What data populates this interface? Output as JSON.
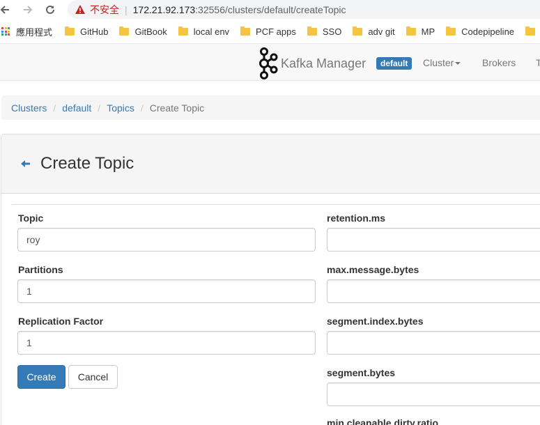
{
  "browser": {
    "insecure_label": "不安全",
    "url_host": "172.21.92.173",
    "url_path": ":32556/clusters/default/createTopic",
    "bookmarks": [
      "應用程式",
      "GitHub",
      "GitBook",
      "local env",
      "PCF apps",
      "SSO",
      "adv git",
      "MP",
      "Codepipeline"
    ]
  },
  "navbar": {
    "brand": "Kafka Manager",
    "cluster_badge": "default",
    "links": [
      "Cluster",
      "Brokers",
      "T"
    ]
  },
  "breadcrumb": {
    "items": [
      "Clusters",
      "default",
      "Topics"
    ],
    "active": "Create Topic"
  },
  "form": {
    "title": "Create Topic",
    "left_fields": [
      {
        "label": "Topic",
        "value": "roy"
      },
      {
        "label": "Partitions",
        "value": "1"
      },
      {
        "label": "Replication Factor",
        "value": "1"
      }
    ],
    "right_fields": [
      {
        "label": "retention.ms",
        "value": ""
      },
      {
        "label": "max.message.bytes",
        "value": ""
      },
      {
        "label": "segment.index.bytes",
        "value": ""
      },
      {
        "label": "segment.bytes",
        "value": ""
      },
      {
        "label": "min.cleanable.dirty.ratio",
        "value": ""
      }
    ],
    "create_label": "Create",
    "cancel_label": "Cancel"
  },
  "colors": {
    "primary": "#337ab7",
    "link": "#337ab7",
    "insecure": "#c5221f",
    "folder": "#f4c542"
  }
}
